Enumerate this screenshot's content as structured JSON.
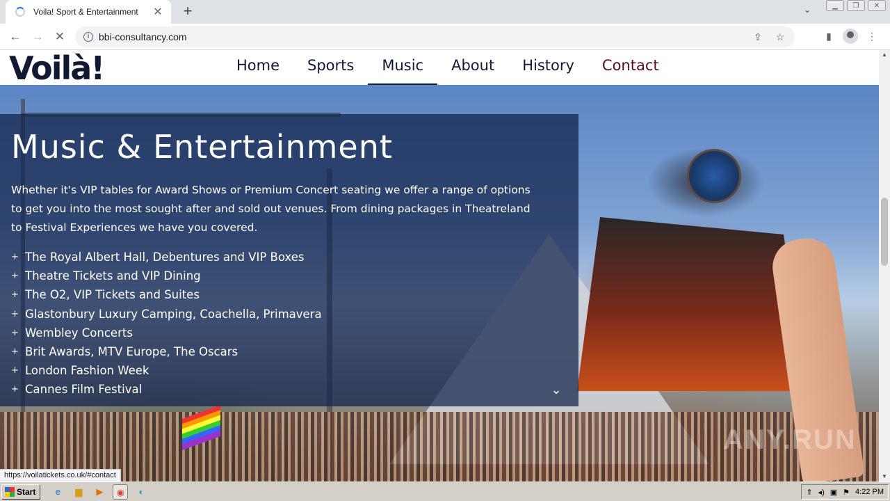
{
  "browser": {
    "tab_title": "Voila! Sport & Entertainment",
    "tab_close": "✕",
    "new_tab": "+",
    "url": "bbi-consultancy.com",
    "status_url": "https://voilatickets.co.uk/#contact"
  },
  "site": {
    "logo": "Voilà!",
    "nav": [
      {
        "label": "Home"
      },
      {
        "label": "Sports"
      },
      {
        "label": "Music"
      },
      {
        "label": "About"
      },
      {
        "label": "History"
      },
      {
        "label": "Contact"
      }
    ],
    "active_nav": "Music"
  },
  "hero": {
    "title": "Music & Entertainment",
    "intro": "Whether it's VIP tables for Award Shows or Premium Concert seating we offer a range of options to get you into the most sought after and sold out venues. From dining packages in Theatreland to Festival Experiences we have you covered.",
    "items": [
      "The Royal Albert Hall, Debentures and VIP Boxes",
      "Theatre Tickets and VIP Dining",
      "The O2, VIP Tickets and Suites",
      "Glastonbury Luxury Camping, Coachella, Primavera",
      "Wembley Concerts",
      "Brit Awards, MTV Europe, The Oscars",
      "London Fashion Week",
      "Cannes Film Festival"
    ]
  },
  "watermark": "ANY.RUN",
  "taskbar": {
    "start_label": "Start",
    "clock": "4:22 PM"
  },
  "icons": {
    "back": "arrow-left-icon",
    "forward": "arrow-right-icon",
    "reload": "stop-icon",
    "site_info": "info-icon",
    "share": "share-icon",
    "bookmark": "star-icon",
    "sidebar": "sidebar-icon",
    "profile": "profile-icon",
    "menu": "kebab-menu-icon",
    "scroll_down": "chevron-down-icon"
  }
}
